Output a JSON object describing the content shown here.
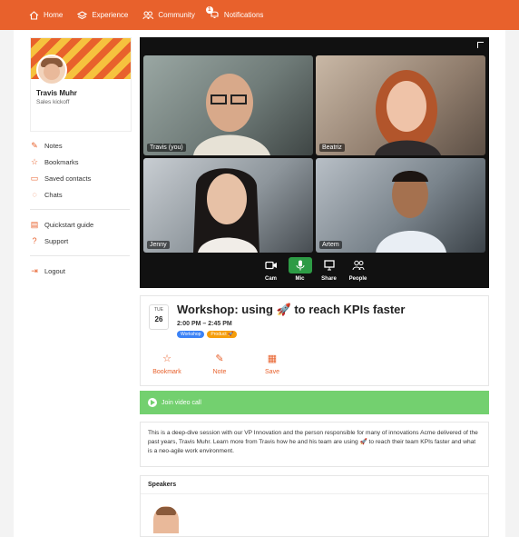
{
  "topnav": {
    "home": "Home",
    "experience": "Experience",
    "community": "Community",
    "notifications": "Notifications",
    "notif_count": "1"
  },
  "profile": {
    "name": "Travis Muhr",
    "subtitle": "Sales kickoff"
  },
  "sidebar": {
    "items": [
      {
        "label": "Notes",
        "icon": "notes-icon"
      },
      {
        "label": "Bookmarks",
        "icon": "star-icon"
      },
      {
        "label": "Saved contacts",
        "icon": "contact-card-icon"
      },
      {
        "label": "Chats",
        "icon": "chat-icon"
      }
    ],
    "items2": [
      {
        "label": "Quickstart guide",
        "icon": "guide-icon"
      },
      {
        "label": "Support",
        "icon": "help-icon"
      }
    ],
    "logout": "Logout"
  },
  "video": {
    "participants": [
      "Travis (you)",
      "Beatriz",
      "Jenny",
      "Artem"
    ],
    "controls": [
      "Cam",
      "Mic",
      "Share",
      "People"
    ]
  },
  "session": {
    "dow": "TUE",
    "day": "26",
    "title": "Workshop: using 🚀 to reach KPIs faster",
    "time": "2:00 PM – 2:45 PM",
    "tags": [
      "Workshop",
      "Product 🚀"
    ],
    "actions": [
      "Bookmark",
      "Note",
      "Save"
    ]
  },
  "join": {
    "label": "Join video call"
  },
  "description": "This is a deep-dive session with our VP Innovation and the person responsible for many of innovations Acme delivered of the past years, Travis Muhr. Learn more from Travis how he and his team are using 🚀 to reach their team KPIs faster and what is a neo-agile work environment.",
  "speakers": {
    "heading": "Speakers"
  },
  "colors": {
    "accent": "#e8612c",
    "join_green": "#73d06f",
    "mic_active": "#2d9b45",
    "tag_blue": "#3b82f6",
    "tag_orange": "#f59e0b"
  }
}
